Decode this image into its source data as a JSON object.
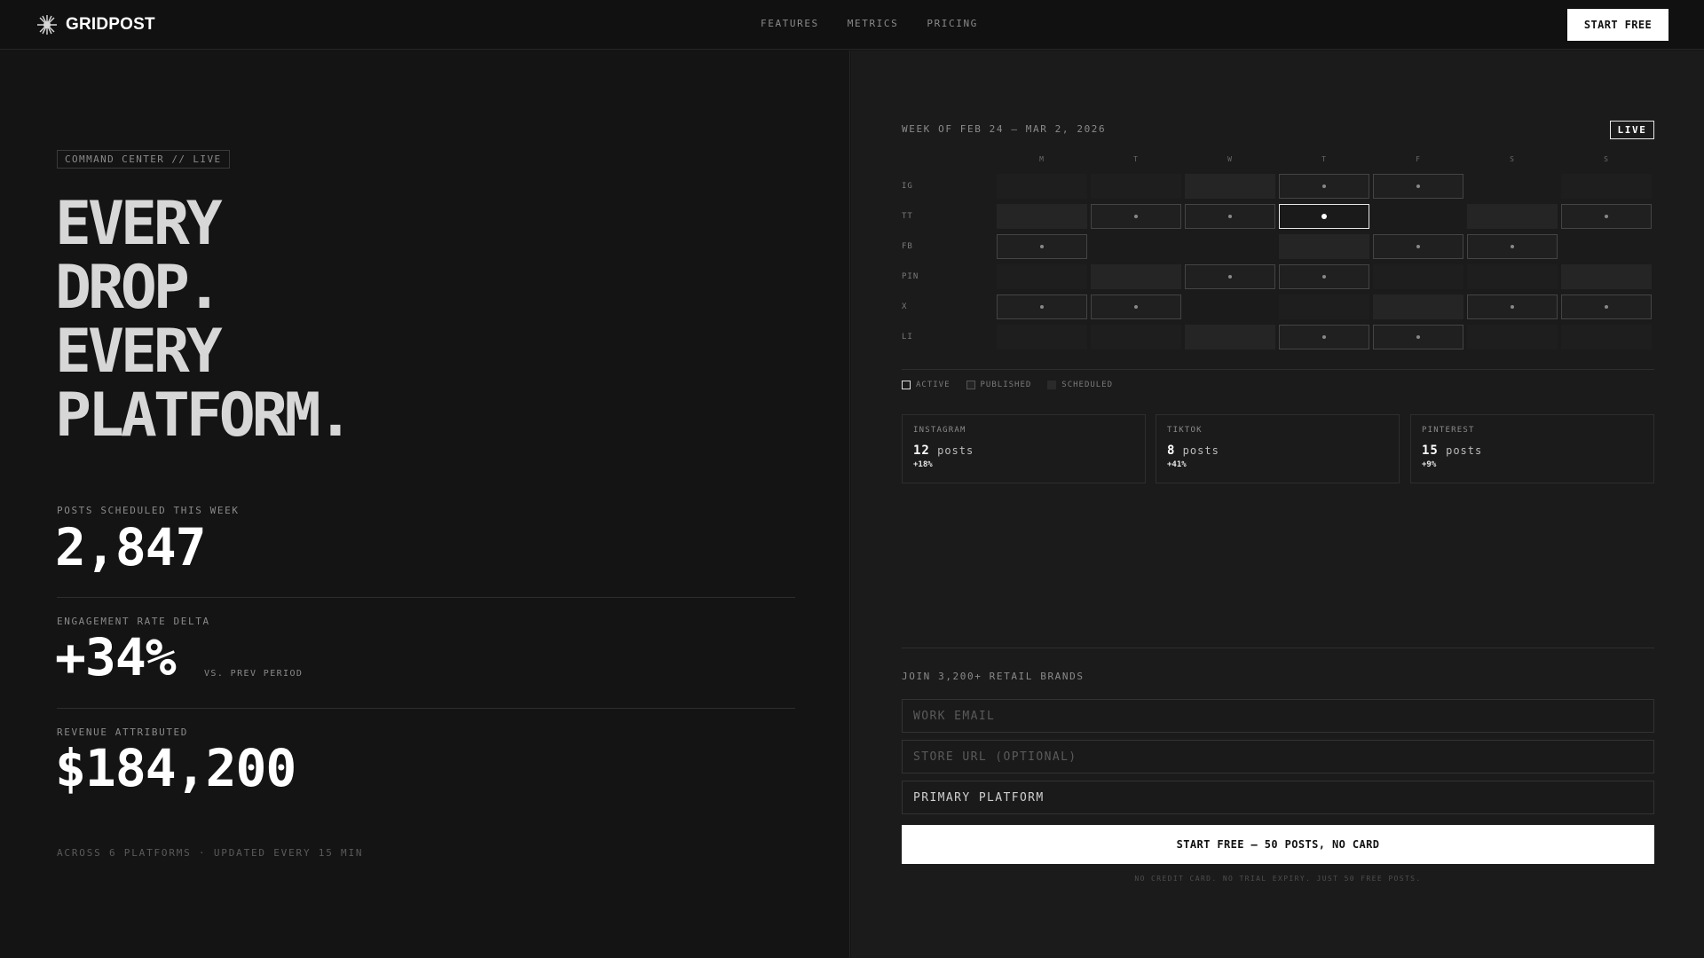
{
  "nav": {
    "brand": "GRIDPOST",
    "brand_icon": "starburst-logo-icon",
    "links": [
      "FEATURES",
      "METRICS",
      "PRICING"
    ],
    "cta": "START FREE"
  },
  "hero": {
    "tag": "COMMAND CENTER // LIVE",
    "headline": [
      "EVERY",
      "DROP.",
      "EVERY",
      "PLATFORM."
    ],
    "metrics": [
      {
        "label": "POSTS SCHEDULED THIS WEEK",
        "value": "2,847",
        "suffix": ""
      },
      {
        "label": "ENGAGEMENT RATE DELTA",
        "value": "+34%",
        "suffix": "VS. PREV PERIOD"
      },
      {
        "label": "REVENUE ATTRIBUTED",
        "value": "$184,200",
        "suffix": ""
      }
    ],
    "footnote": "ACROSS 6 PLATFORMS · UPDATED EVERY 15 MIN"
  },
  "calendar": {
    "week": "WEEK OF FEB 24 — MAR 2, 2026",
    "live": "LIVE",
    "days": [
      "M",
      "T",
      "W",
      "T",
      "F",
      "S",
      "S"
    ],
    "rows": [
      {
        "label": "IG",
        "cells": [
          "empty",
          "empty",
          "scheduled",
          "published-dot",
          "published-dot",
          "none",
          "empty"
        ]
      },
      {
        "label": "TT",
        "cells": [
          "scheduled",
          "published-dot",
          "published-dot",
          "active-dot",
          "none",
          "scheduled",
          "published-dot"
        ]
      },
      {
        "label": "FB",
        "cells": [
          "published-dot",
          "none",
          "none",
          "scheduled",
          "published-dot",
          "published-dot",
          "none"
        ]
      },
      {
        "label": "PIN",
        "cells": [
          "empty",
          "scheduled",
          "published-dot",
          "published-dot",
          "empty",
          "empty",
          "scheduled"
        ]
      },
      {
        "label": "X",
        "cells": [
          "published-dot",
          "published-dot",
          "none",
          "empty",
          "scheduled",
          "published-dot",
          "published-dot"
        ]
      },
      {
        "label": "LI",
        "cells": [
          "empty",
          "empty",
          "scheduled",
          "published-dot",
          "published-dot",
          "empty",
          "empty"
        ]
      }
    ],
    "legend": [
      "ACTIVE",
      "PUBLISHED",
      "SCHEDULED"
    ]
  },
  "stats": [
    {
      "name": "INSTAGRAM",
      "count": "12",
      "unit": "posts",
      "delta": "+18%"
    },
    {
      "name": "TIKTOK",
      "count": "8",
      "unit": "posts",
      "delta": "+41%"
    },
    {
      "name": "PINTEREST",
      "count": "15",
      "unit": "posts",
      "delta": "+9%"
    }
  ],
  "signup": {
    "label": "JOIN 3,200+ RETAIL BRANDS",
    "email_placeholder": "WORK EMAIL",
    "store_placeholder": "STORE URL (OPTIONAL)",
    "platform_select": "PRIMARY PLATFORM",
    "submit": "START FREE — 50 POSTS, NO CARD",
    "disclaimer": "NO CREDIT CARD. NO TRIAL EXPIRY. JUST 50 FREE POSTS."
  }
}
